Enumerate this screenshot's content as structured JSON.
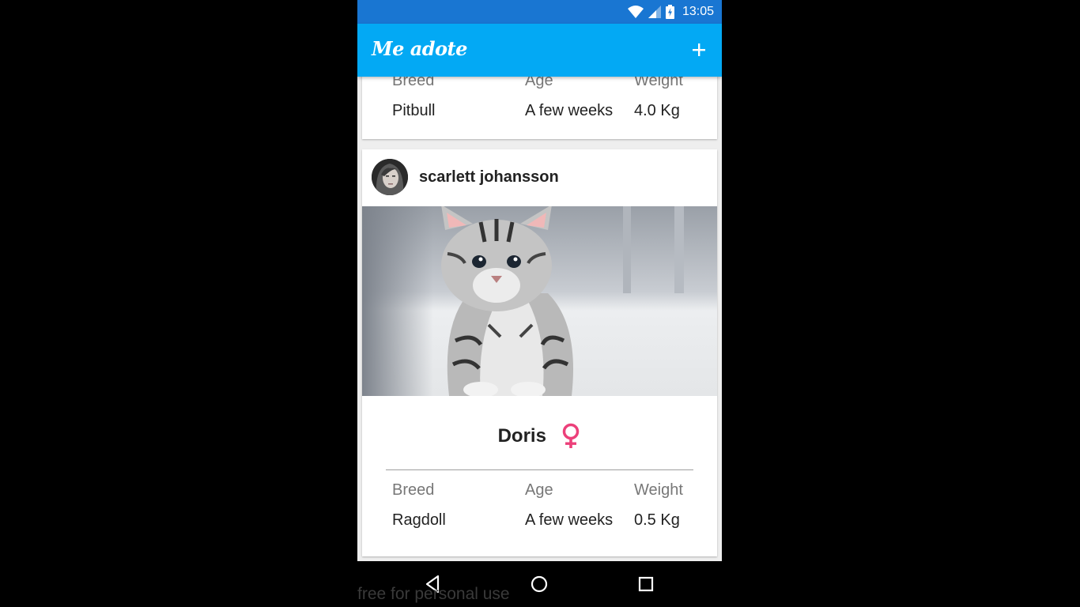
{
  "status_bar": {
    "time": "13:05",
    "icons": [
      "wifi-icon",
      "cell-signal-icon",
      "battery-charging-icon"
    ],
    "color": "#1976d2"
  },
  "app_bar": {
    "title": "Me adote",
    "add_icon": "plus-icon",
    "color": "#03a9f4"
  },
  "cards": [
    {
      "breed_label": "Breed",
      "age_label": "Age",
      "weight_label": "Weight",
      "breed": "Pitbull",
      "age": "A few weeks",
      "weight": "4.0 Kg"
    },
    {
      "owner_name": "scarlett johansson",
      "pet_name": "Doris",
      "gender_icon": "female-icon",
      "gender_color": "#ec407a",
      "breed_label": "Breed",
      "age_label": "Age",
      "weight_label": "Weight",
      "breed": "Ragdoll",
      "age": "A few weeks",
      "weight": "0.5 Kg"
    }
  ],
  "nav_bar": {
    "buttons": [
      "back-icon",
      "home-icon",
      "recents-icon"
    ]
  },
  "watermark": "free for personal use"
}
